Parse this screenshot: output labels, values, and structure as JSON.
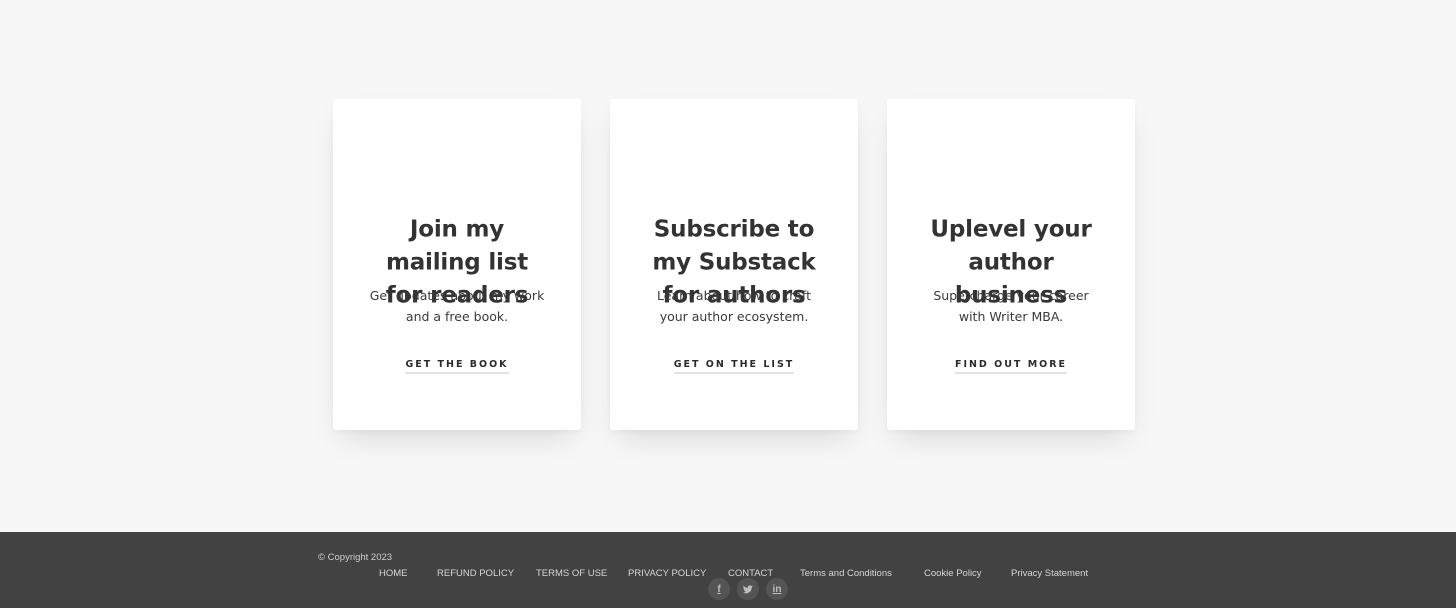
{
  "cards": [
    {
      "title_lines": [
        "Join my",
        "mailing list",
        "for readers"
      ],
      "desc_lines": [
        "Get updates about my work",
        "and a free book."
      ],
      "cta": "GET THE BOOK"
    },
    {
      "title_lines": [
        "Subscribe to",
        "my Substack",
        "for authors"
      ],
      "desc_lines": [
        "Learn about how to craft",
        "your author ecosystem."
      ],
      "cta": "GET ON THE LIST"
    },
    {
      "title_lines": [
        "Uplevel your",
        "author",
        "business"
      ],
      "desc_lines": [
        "Supercharge your career",
        "with Writer MBA."
      ],
      "cta": "FIND OUT MORE"
    }
  ],
  "footer": {
    "copyright": "© Copyright 2023",
    "nav": [
      "HOME",
      "REFUND POLICY",
      "TERMS OF USE",
      "PRIVACY POLICY",
      "CONTACT",
      "Terms and Conditions",
      "Cookie Policy",
      "Privacy Statement"
    ],
    "social": [
      {
        "icon": "facebook-icon",
        "glyph": "f"
      },
      {
        "icon": "twitter-icon",
        "glyph": ""
      },
      {
        "icon": "linkedin-icon",
        "glyph": "in"
      }
    ]
  },
  "colors": {
    "page_bg": "#f7f7f7",
    "card_bg": "#ffffff",
    "heading": "#333333",
    "footer_bg": "#424242",
    "footer_text": "#d6d6d6"
  }
}
